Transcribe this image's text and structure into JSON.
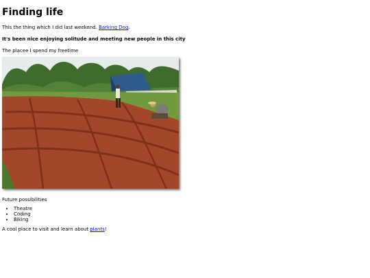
{
  "heading": "Finding life",
  "intro": {
    "text": "This the thing which I did last weekend. ",
    "link_text": "Barking Dog",
    "suffix": "."
  },
  "bold_line": "It's been nice enjoying solitude and meeting new people in this city",
  "photo_caption": "The placee I spend my freetime",
  "future": {
    "label": "Future possibilities",
    "items": [
      "Theatre",
      "Coding",
      "Biking"
    ]
  },
  "outro": {
    "text": "A cool place to visit and learn about ",
    "link_text": "plants",
    "suffix": "!"
  },
  "colors": {
    "link": "#0000ee",
    "soil": "#a3472a",
    "grass": "#6f9a3e"
  }
}
